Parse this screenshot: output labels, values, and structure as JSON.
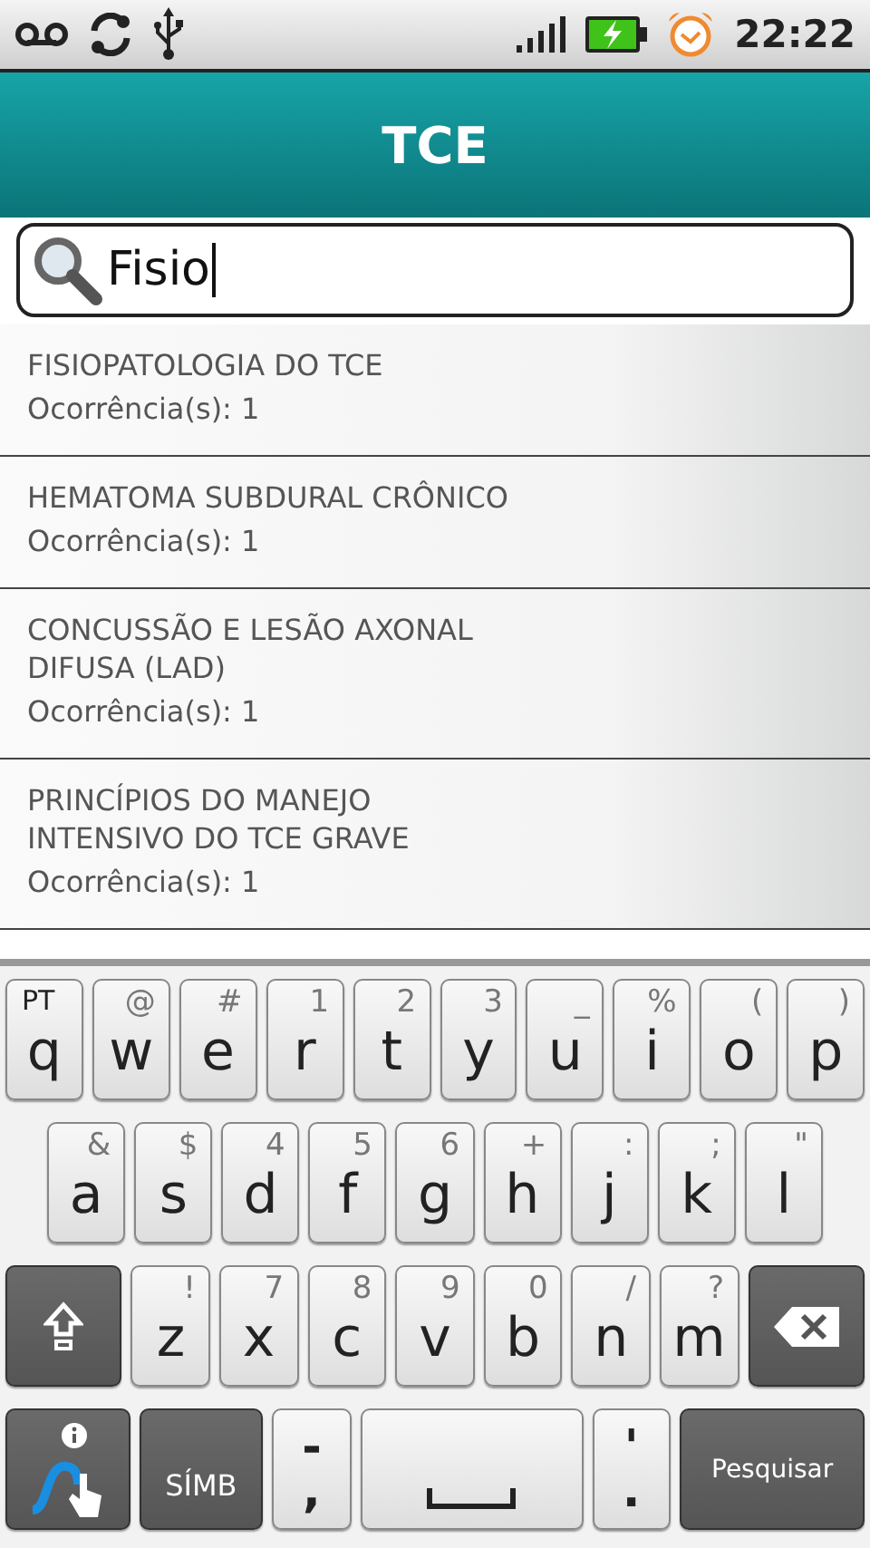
{
  "status_bar": {
    "time": "22:22"
  },
  "title": "TCE",
  "search": {
    "value": "Fisio"
  },
  "results": [
    {
      "title": "FISIOPATOLOGIA DO TCE",
      "count": "Ocorrência(s): 1"
    },
    {
      "title": "HEMATOMA SUBDURAL CRÔNICO",
      "count": "Ocorrência(s): 1"
    },
    {
      "title": "CONCUSSÃO E LESÃO AXONAL DIFUSA (LAD)",
      "count": "Ocorrência(s): 1"
    },
    {
      "title": "PRINCÍPIOS DO MANEJO INTENSIVO DO TCE GRAVE",
      "count": "Ocorrência(s): 1"
    }
  ],
  "keyboard": {
    "top_row": {
      "keys": [
        {
          "kind": "letter",
          "main": "q",
          "alt": "PT"
        },
        {
          "kind": "letter",
          "main": "w",
          "alt": "@"
        },
        {
          "kind": "letter",
          "main": "e",
          "alt": "#"
        },
        {
          "kind": "letter",
          "main": "r",
          "alt": "1"
        },
        {
          "kind": "letter",
          "main": "t",
          "alt": "2"
        },
        {
          "kind": "letter",
          "main": "y",
          "alt": "3"
        },
        {
          "kind": "letter",
          "main": "u",
          "alt": "_"
        },
        {
          "kind": "letter",
          "main": "i",
          "alt": "%"
        },
        {
          "kind": "letter",
          "main": "o",
          "alt": "("
        },
        {
          "kind": "letter",
          "main": "p",
          "alt": ")"
        }
      ]
    },
    "home_row": {
      "keys": [
        {
          "kind": "letter",
          "main": "a",
          "alt": "&"
        },
        {
          "kind": "letter",
          "main": "s",
          "alt": "$"
        },
        {
          "kind": "letter",
          "main": "d",
          "alt": "4"
        },
        {
          "kind": "letter",
          "main": "f",
          "alt": "5"
        },
        {
          "kind": "letter",
          "main": "g",
          "alt": "6"
        },
        {
          "kind": "letter",
          "main": "h",
          "alt": "+"
        },
        {
          "kind": "letter",
          "main": "j",
          "alt": ":"
        },
        {
          "kind": "letter",
          "main": "k",
          "alt": ";"
        },
        {
          "kind": "letter",
          "main": "l",
          "alt": "\""
        }
      ]
    },
    "bottom_row": {
      "keys": [
        {
          "kind": "shift"
        },
        {
          "kind": "letter",
          "main": "z",
          "alt": "!"
        },
        {
          "kind": "letter",
          "main": "x",
          "alt": "7"
        },
        {
          "kind": "letter",
          "main": "c",
          "alt": "8"
        },
        {
          "kind": "letter",
          "main": "v",
          "alt": "9"
        },
        {
          "kind": "letter",
          "main": "b",
          "alt": "0"
        },
        {
          "kind": "letter",
          "main": "n",
          "alt": "/"
        },
        {
          "kind": "letter",
          "main": "m",
          "alt": "?"
        },
        {
          "kind": "backspace"
        }
      ]
    },
    "function_row": {
      "keys": [
        {
          "kind": "swype"
        },
        {
          "kind": "symbols",
          "main": "SÍMB"
        },
        {
          "kind": "punct",
          "main": ",",
          "alt": "-"
        },
        {
          "kind": "space"
        },
        {
          "kind": "punct",
          "main": ".",
          "alt": "'"
        },
        {
          "kind": "action",
          "main": "Pesquisar"
        }
      ]
    }
  }
}
